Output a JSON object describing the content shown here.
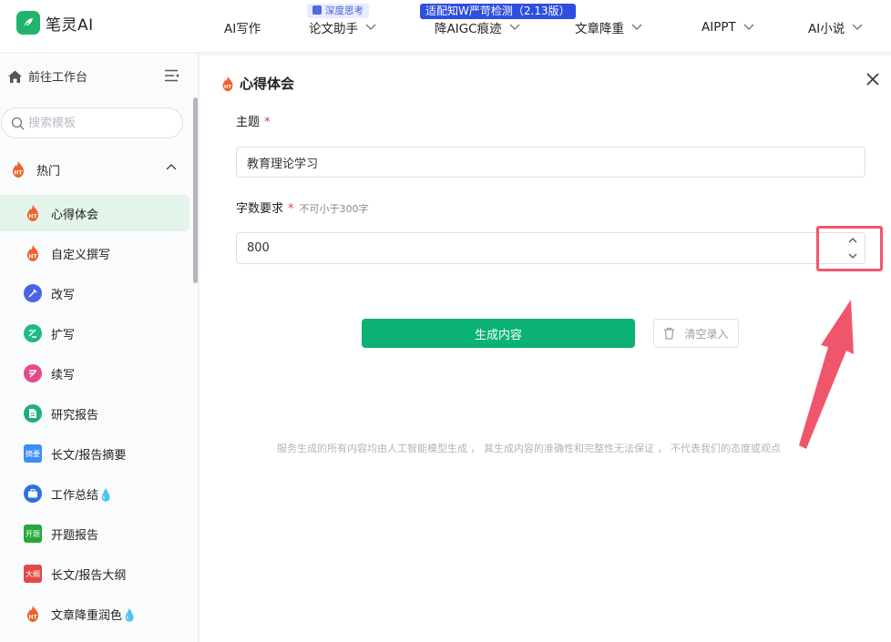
{
  "brand": {
    "name": "笔灵AI"
  },
  "nav": {
    "items": [
      {
        "label": "AI写作",
        "chevron": false
      },
      {
        "label": "论文助手",
        "chevron": true
      },
      {
        "label": "降AIGC痕迹",
        "chevron": true
      },
      {
        "label": "文章降重",
        "chevron": true
      },
      {
        "label": "AIPPT",
        "chevron": true
      },
      {
        "label": "AI小说",
        "chevron": true
      }
    ],
    "badge_deep_think": "深度思考",
    "badge_promo": "适配知W严苛检测（2.13版）"
  },
  "sidebar": {
    "workbench_label": "前往工作台",
    "search": {
      "placeholder": "搜索模板",
      "value": ""
    },
    "group": {
      "label": "热门",
      "icon": "fire-ht-icon",
      "expanded": true
    },
    "items": [
      {
        "label": "心得体会",
        "icon": "fire-ht-icon",
        "active": true
      },
      {
        "label": "自定义撰写",
        "icon": "fire-ht-icon",
        "active": false
      },
      {
        "label": "改写",
        "icon": "rewrite-icon",
        "active": false
      },
      {
        "label": "扩写",
        "icon": "expand-icon",
        "active": false
      },
      {
        "label": "续写",
        "icon": "continue-icon",
        "active": false
      },
      {
        "label": "研究报告",
        "icon": "document-icon",
        "active": false
      },
      {
        "label": "长文/报告摘要",
        "icon": "summary-icon",
        "badge_text": "摘要",
        "active": false
      },
      {
        "label": "工作总结💧",
        "icon": "briefcase-icon",
        "active": false
      },
      {
        "label": "开题报告",
        "icon": "proposal-icon",
        "badge_text": "开题",
        "active": false
      },
      {
        "label": "长文/报告大纲",
        "icon": "outline-icon",
        "badge_text": "大纲",
        "active": false
      },
      {
        "label": "文章降重润色💧",
        "icon": "fire-ht-icon",
        "active": false
      }
    ]
  },
  "form": {
    "title": "心得体会",
    "fields": {
      "topic": {
        "label": "主题",
        "required_mark": "*",
        "value": "教育理论学习"
      },
      "word_count": {
        "label": "字数要求",
        "required_mark": "*",
        "hint": "不可小于300字",
        "value": "800"
      }
    },
    "generate_label": "生成内容",
    "clear_label": "清空录入",
    "disclaimer": "服务生成的所有内容均由人工智能模型生成 ， 其生成内容的准确性和完整性无法保证 ， 不代表我们的态度或观点"
  },
  "colors": {
    "accent": "#0bb274",
    "active_bg": "#e3f4ea",
    "annotation": "#f0566b",
    "promo_badge": "#2f4ee0"
  }
}
